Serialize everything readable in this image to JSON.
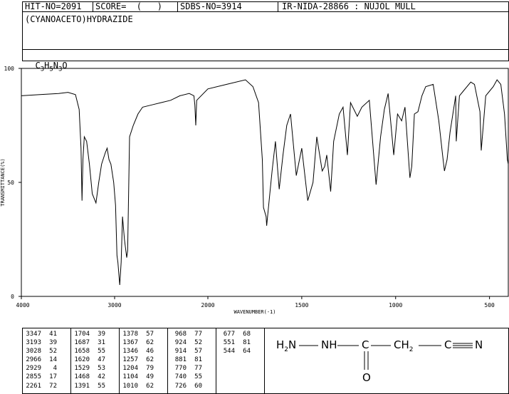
{
  "header": {
    "hit_no": "HIT-NO=2091",
    "score": "SCORE=  (   )",
    "sdbs_no": "SDBS-NO=3914",
    "ir_id": "IR-NIDA-28866 : NUJOL MULL"
  },
  "compound": {
    "name": "(CYANOACETO)HYDRAZIDE",
    "formula_parts": [
      "C",
      "3",
      "H",
      "5",
      "N",
      "3",
      "O"
    ]
  },
  "structure": {
    "h2n": "H2N",
    "nh": "NH",
    "c1": "C",
    "ch2": "CH2",
    "c2": "C",
    "n": "N",
    "o": "O"
  },
  "chart_data": {
    "type": "line",
    "xlabel": "WAVENUMBER(-1)",
    "ylabel": "TRANSMITTANCE(%)",
    "xlim": [
      4000,
      400
    ],
    "ylim": [
      0,
      100
    ],
    "x_ticks": [
      "4000",
      "3000",
      "2000",
      "1500",
      "1000",
      "500"
    ],
    "y_ticks": [
      "100",
      "50",
      "0"
    ],
    "series": [
      {
        "points": [
          [
            4000,
            88
          ],
          [
            3800,
            88.5
          ],
          [
            3600,
            89
          ],
          [
            3500,
            89.5
          ],
          [
            3420,
            88.5
          ],
          [
            3380,
            82
          ],
          [
            3360,
            65
          ],
          [
            3350,
            42
          ],
          [
            3340,
            60
          ],
          [
            3325,
            70
          ],
          [
            3300,
            68
          ],
          [
            3270,
            58
          ],
          [
            3240,
            45
          ],
          [
            3200,
            41
          ],
          [
            3170,
            50
          ],
          [
            3140,
            58
          ],
          [
            3100,
            63
          ],
          [
            3080,
            65
          ],
          [
            3060,
            60
          ],
          [
            3040,
            58
          ],
          [
            3010,
            50
          ],
          [
            2990,
            40
          ],
          [
            2975,
            18
          ],
          [
            2965,
            15
          ],
          [
            2945,
            5
          ],
          [
            2930,
            15
          ],
          [
            2915,
            35
          ],
          [
            2895,
            25
          ],
          [
            2870,
            17
          ],
          [
            2860,
            20
          ],
          [
            2840,
            70
          ],
          [
            2800,
            75
          ],
          [
            2750,
            80
          ],
          [
            2700,
            83
          ],
          [
            2600,
            84
          ],
          [
            2500,
            85
          ],
          [
            2400,
            86
          ],
          [
            2300,
            88
          ],
          [
            2200,
            89
          ],
          [
            2150,
            88
          ],
          [
            2140,
            84
          ],
          [
            2130,
            75
          ],
          [
            2120,
            86
          ],
          [
            2000,
            91
          ],
          [
            1900,
            93
          ],
          [
            1800,
            95
          ],
          [
            1760,
            92
          ],
          [
            1730,
            85
          ],
          [
            1710,
            60
          ],
          [
            1704,
            39
          ],
          [
            1690,
            35
          ],
          [
            1687,
            31
          ],
          [
            1670,
            45
          ],
          [
            1658,
            55
          ],
          [
            1640,
            68
          ],
          [
            1620,
            47
          ],
          [
            1600,
            62
          ],
          [
            1580,
            75
          ],
          [
            1560,
            80
          ],
          [
            1529,
            53
          ],
          [
            1500,
            65
          ],
          [
            1468,
            42
          ],
          [
            1440,
            50
          ],
          [
            1420,
            70
          ],
          [
            1391,
            55
          ],
          [
            1378,
            57
          ],
          [
            1367,
            62
          ],
          [
            1346,
            46
          ],
          [
            1330,
            68
          ],
          [
            1300,
            80
          ],
          [
            1280,
            83
          ],
          [
            1257,
            62
          ],
          [
            1240,
            85
          ],
          [
            1204,
            79
          ],
          [
            1180,
            83
          ],
          [
            1140,
            86
          ],
          [
            1104,
            49
          ],
          [
            1080,
            70
          ],
          [
            1060,
            82
          ],
          [
            1040,
            89
          ],
          [
            1010,
            62
          ],
          [
            990,
            80
          ],
          [
            968,
            77
          ],
          [
            950,
            83
          ],
          [
            924,
            52
          ],
          [
            914,
            57
          ],
          [
            900,
            80
          ],
          [
            881,
            81
          ],
          [
            860,
            88
          ],
          [
            840,
            92
          ],
          [
            800,
            93
          ],
          [
            770,
            77
          ],
          [
            750,
            62
          ],
          [
            740,
            55
          ],
          [
            726,
            60
          ],
          [
            710,
            72
          ],
          [
            680,
            88
          ],
          [
            677,
            68
          ],
          [
            660,
            88
          ],
          [
            640,
            90
          ],
          [
            600,
            94
          ],
          [
            580,
            93
          ],
          [
            551,
            81
          ],
          [
            544,
            64
          ],
          [
            520,
            88
          ],
          [
            500,
            90
          ],
          [
            480,
            92
          ],
          [
            460,
            95
          ],
          [
            440,
            93
          ],
          [
            420,
            80
          ],
          [
            405,
            60
          ],
          [
            400,
            58
          ]
        ]
      }
    ],
    "peaks": [
      [
        [
          "3347",
          "41"
        ],
        [
          "3193",
          "39"
        ],
        [
          "3028",
          "52"
        ],
        [
          "2966",
          "14"
        ],
        [
          "2929",
          "4"
        ],
        [
          "2855",
          "17"
        ],
        [
          "2261",
          "72"
        ]
      ],
      [
        [
          "1704",
          "39"
        ],
        [
          "1687",
          "31"
        ],
        [
          "1658",
          "55"
        ],
        [
          "1620",
          "47"
        ],
        [
          "1529",
          "53"
        ],
        [
          "1468",
          "42"
        ],
        [
          "1391",
          "55"
        ]
      ],
      [
        [
          "1378",
          "57"
        ],
        [
          "1367",
          "62"
        ],
        [
          "1346",
          "46"
        ],
        [
          "1257",
          "62"
        ],
        [
          "1204",
          "79"
        ],
        [
          "1104",
          "49"
        ],
        [
          "1010",
          "62"
        ]
      ],
      [
        [
          "968",
          "77"
        ],
        [
          "924",
          "52"
        ],
        [
          "914",
          "57"
        ],
        [
          "881",
          "81"
        ],
        [
          "770",
          "77"
        ],
        [
          "740",
          "55"
        ],
        [
          "726",
          "60"
        ]
      ],
      [
        [
          "677",
          "68"
        ],
        [
          "551",
          "81"
        ],
        [
          "544",
          "64"
        ]
      ]
    ]
  }
}
